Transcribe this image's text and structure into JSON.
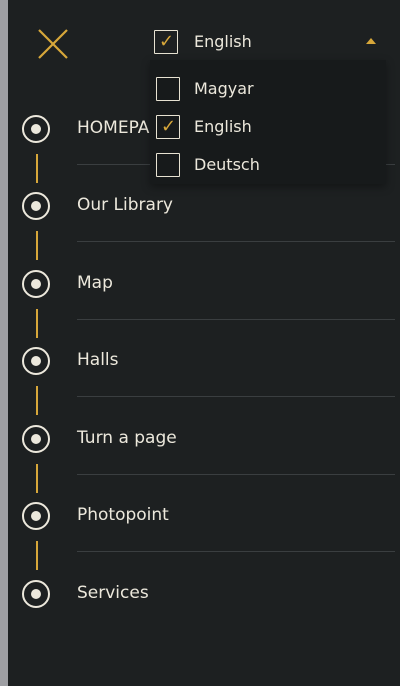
{
  "colors": {
    "panel_background": "#1d2021",
    "accent": "#d7a73a",
    "text": "#ece8dc",
    "divider": "#3a3e40",
    "dropdown_background": "#171a1b"
  },
  "menu": {
    "close_icon": "close-x-icon",
    "language_selector": {
      "selected_label": "English",
      "selected_checked": true,
      "caret_icon": "caret-up-icon",
      "options": [
        {
          "label": "Magyar",
          "checked": false
        },
        {
          "label": "English",
          "checked": true
        },
        {
          "label": "Deutsch",
          "checked": false
        }
      ]
    },
    "nav_items": [
      {
        "label": "HOMEPAGE",
        "icon": "timeline-node-icon"
      },
      {
        "label": "Our Library",
        "icon": "timeline-node-icon"
      },
      {
        "label": "Map",
        "icon": "timeline-node-icon"
      },
      {
        "label": "Halls",
        "icon": "timeline-node-icon"
      },
      {
        "label": "Turn a page",
        "icon": "timeline-node-icon"
      },
      {
        "label": "Photopoint",
        "icon": "timeline-node-icon"
      },
      {
        "label": "Services",
        "icon": "timeline-node-icon"
      }
    ]
  }
}
